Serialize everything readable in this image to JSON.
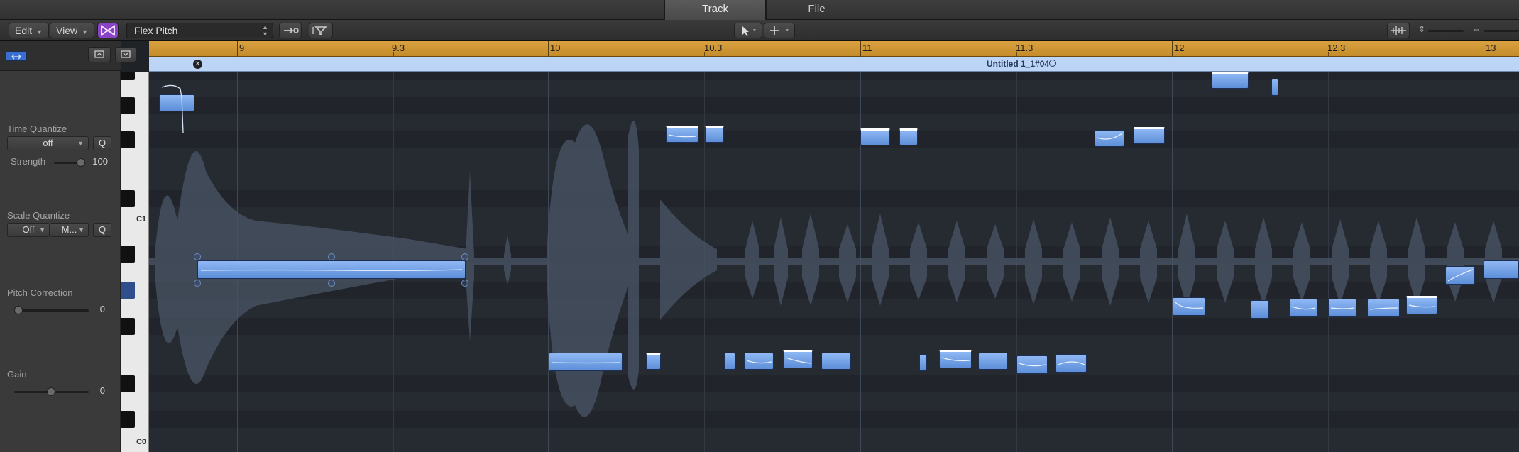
{
  "tabs": [
    {
      "label": "Track",
      "active": true
    },
    {
      "label": "File",
      "active": false
    }
  ],
  "toolbar": {
    "edit_label": "Edit",
    "view_label": "View",
    "mode_value": "Flex Pitch"
  },
  "inspector": {
    "time_quantize": {
      "label": "Time Quantize",
      "value": "off",
      "q": "Q"
    },
    "strength": {
      "label": "Strength",
      "value": "100"
    },
    "scale_quantize": {
      "label": "Scale Quantize",
      "value": "Off",
      "scale": "M...",
      "q": "Q"
    },
    "pitch_correction": {
      "label": "Pitch Correction",
      "value": "0"
    },
    "gain": {
      "label": "Gain",
      "value": "0"
    }
  },
  "piano": {
    "labels": [
      "C1",
      "C0"
    ]
  },
  "ruler": {
    "bars": [
      "9",
      "9.3",
      "10",
      "10.3",
      "11",
      "11.3",
      "12",
      "12.3",
      "13"
    ]
  },
  "region": {
    "title": "Untitled 1_1#04"
  },
  "colors": {
    "ruler": "#d9a140",
    "note": "#7aa7ea",
    "region_header": "#bcd4f5",
    "background": "#262a31"
  }
}
